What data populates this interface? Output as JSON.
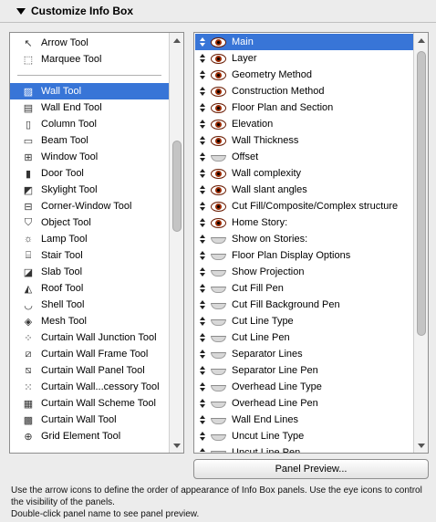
{
  "header": {
    "title": "Customize Info Box"
  },
  "tools": {
    "top": [
      {
        "label": "Arrow Tool",
        "icon": "arrow-tool-icon",
        "glyph": "↖"
      },
      {
        "label": "Marquee Tool",
        "icon": "marquee-tool-icon",
        "glyph": "⬚"
      }
    ],
    "items": [
      {
        "label": "Wall Tool",
        "icon": "wall-tool-icon",
        "glyph": "▨",
        "selected": true
      },
      {
        "label": "Wall End Tool",
        "icon": "wall-end-tool-icon",
        "glyph": "▤"
      },
      {
        "label": "Column Tool",
        "icon": "column-tool-icon",
        "glyph": "▯"
      },
      {
        "label": "Beam Tool",
        "icon": "beam-tool-icon",
        "glyph": "▭"
      },
      {
        "label": "Window Tool",
        "icon": "window-tool-icon",
        "glyph": "⊞"
      },
      {
        "label": "Door Tool",
        "icon": "door-tool-icon",
        "glyph": "▮"
      },
      {
        "label": "Skylight Tool",
        "icon": "skylight-tool-icon",
        "glyph": "◩"
      },
      {
        "label": "Corner-Window Tool",
        "icon": "corner-window-tool-icon",
        "glyph": "⊟"
      },
      {
        "label": "Object Tool",
        "icon": "object-tool-icon",
        "glyph": "⛉"
      },
      {
        "label": "Lamp Tool",
        "icon": "lamp-tool-icon",
        "glyph": "☼"
      },
      {
        "label": "Stair Tool",
        "icon": "stair-tool-icon",
        "glyph": "⌸"
      },
      {
        "label": "Slab Tool",
        "icon": "slab-tool-icon",
        "glyph": "◪"
      },
      {
        "label": "Roof Tool",
        "icon": "roof-tool-icon",
        "glyph": "◭"
      },
      {
        "label": "Shell Tool",
        "icon": "shell-tool-icon",
        "glyph": "◡"
      },
      {
        "label": "Mesh Tool",
        "icon": "mesh-tool-icon",
        "glyph": "◈"
      },
      {
        "label": "Curtain Wall Junction Tool",
        "icon": "curtain-wall-junction-tool-icon",
        "glyph": "⁘"
      },
      {
        "label": "Curtain Wall Frame Tool",
        "icon": "curtain-wall-frame-tool-icon",
        "glyph": "⧄"
      },
      {
        "label": "Curtain Wall Panel Tool",
        "icon": "curtain-wall-panel-tool-icon",
        "glyph": "⧅"
      },
      {
        "label": "Curtain Wall...cessory Tool",
        "icon": "curtain-wall-accessory-tool-icon",
        "glyph": "⁙"
      },
      {
        "label": "Curtain Wall Scheme Tool",
        "icon": "curtain-wall-scheme-tool-icon",
        "glyph": "▦"
      },
      {
        "label": "Curtain Wall Tool",
        "icon": "curtain-wall-tool-icon",
        "glyph": "▩"
      },
      {
        "label": "Grid Element Tool",
        "icon": "grid-element-tool-icon",
        "glyph": "⊕"
      }
    ]
  },
  "panels": [
    {
      "label": "Main",
      "visible": true,
      "selected": true
    },
    {
      "label": "Layer",
      "visible": true
    },
    {
      "label": "Geometry Method",
      "visible": true
    },
    {
      "label": "Construction Method",
      "visible": true
    },
    {
      "label": "Floor Plan and Section",
      "visible": true
    },
    {
      "label": "Elevation",
      "visible": true
    },
    {
      "label": "Wall Thickness",
      "visible": true
    },
    {
      "label": "Offset",
      "visible": false
    },
    {
      "label": "Wall complexity",
      "visible": true
    },
    {
      "label": "Wall slant angles",
      "visible": true
    },
    {
      "label": "Cut Fill/Composite/Complex structure",
      "visible": true
    },
    {
      "label": "Home Story:",
      "visible": true
    },
    {
      "label": "Show on Stories:",
      "visible": false
    },
    {
      "label": "Floor Plan Display Options",
      "visible": false
    },
    {
      "label": "Show Projection",
      "visible": false
    },
    {
      "label": "Cut Fill Pen",
      "visible": false
    },
    {
      "label": "Cut Fill Background Pen",
      "visible": false
    },
    {
      "label": "Cut Line Type",
      "visible": false
    },
    {
      "label": "Cut Line Pen",
      "visible": false
    },
    {
      "label": "Separator Lines",
      "visible": false
    },
    {
      "label": "Separator Line Pen",
      "visible": false
    },
    {
      "label": "Overhead Line Type",
      "visible": false
    },
    {
      "label": "Overhead Line Pen",
      "visible": false
    },
    {
      "label": "Wall End Lines",
      "visible": false
    },
    {
      "label": "Uncut Line Type",
      "visible": false
    },
    {
      "label": "Uncut Line Pen",
      "visible": false
    }
  ],
  "buttons": {
    "panel_preview": "Panel Preview..."
  },
  "help": {
    "line1": "Use the arrow icons to define the order of appearance of Info Box panels. Use the eye icons to control the visibility of the panels.",
    "line2": "Double-click panel name to see panel preview."
  },
  "colors": {
    "selection": "#3875d7",
    "eye_open": "#9b2a00"
  }
}
